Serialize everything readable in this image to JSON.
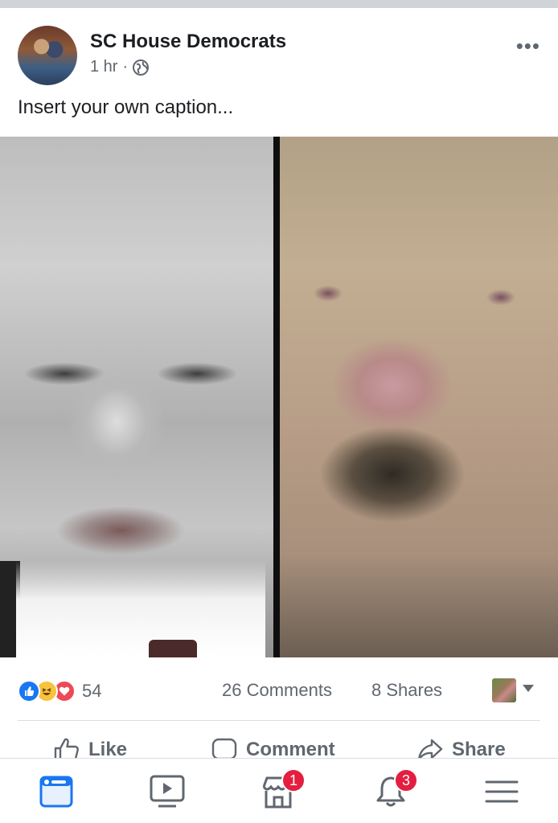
{
  "post": {
    "author": "SC House Democrats",
    "time": "1 hr",
    "separator": "·",
    "caption": "Insert your own caption...",
    "more_label": "•••"
  },
  "stats": {
    "reaction_count": "54",
    "comments": "26 Comments",
    "shares": "8 Shares",
    "reactions": [
      "like-icon",
      "haha-icon",
      "love-icon"
    ]
  },
  "actions": {
    "like": "Like",
    "comment": "Comment",
    "share": "Share"
  },
  "tabbar": {
    "active_color": "#1877f2",
    "marketplace_badge": "1",
    "notifications_badge": "3"
  }
}
